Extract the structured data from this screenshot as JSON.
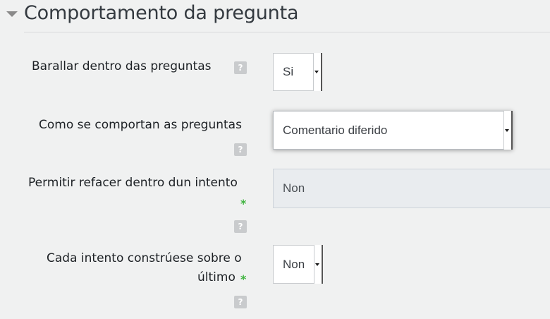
{
  "section": {
    "title": "Comportamento da pregunta",
    "toggle_icon": "caret-down-icon"
  },
  "fields": [
    {
      "label": "Barallar dentro das preguntas",
      "value": "Si",
      "help_icon": "help-icon"
    },
    {
      "label": "Como se comportan as preguntas",
      "value": "Comentario diferido",
      "help_icon": "help-icon"
    },
    {
      "label": "Permitir refacer dentro dun intento",
      "value": "Non",
      "required_marker": "*",
      "help_icon": "help-icon",
      "disabled": true
    },
    {
      "label_line1": "Cada intento constrúese sobre o",
      "label_line2": "último",
      "value": "Non",
      "required_marker": "*",
      "help_icon": "help-icon"
    }
  ],
  "colors": {
    "background": "#f0f1f1",
    "required": "#3fb33f",
    "help_icon": "#c9cbcd"
  }
}
